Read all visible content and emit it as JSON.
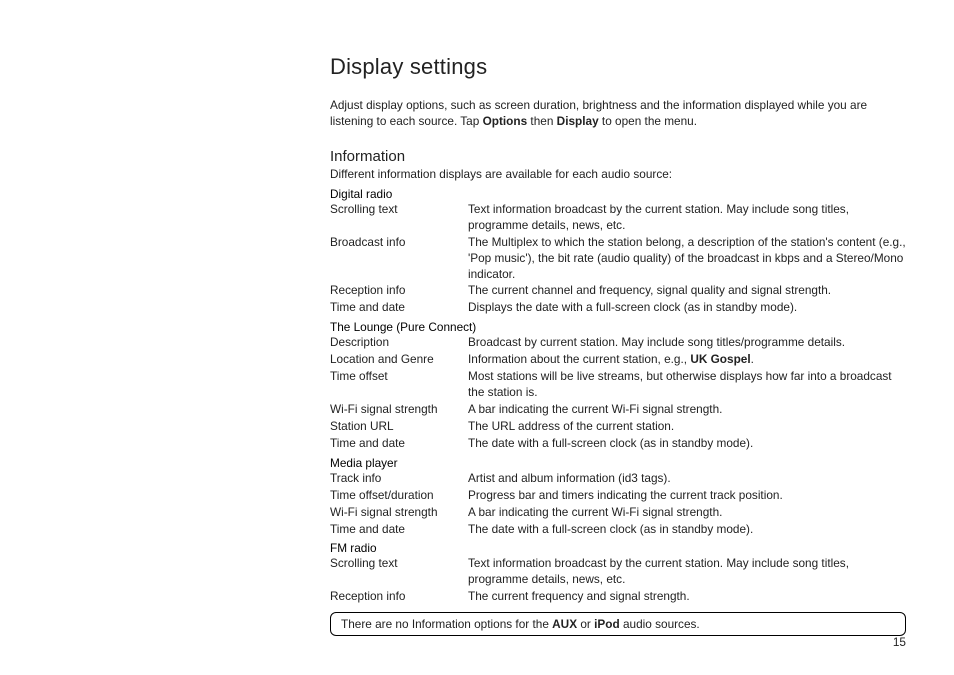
{
  "title": "Display settings",
  "intro_pre": "Adjust display options, such as screen duration, brightness and the information displayed while you are listening to each source. Tap ",
  "intro_b1": "Options",
  "intro_mid": " then ",
  "intro_b2": "Display",
  "intro_post": " to open the menu.",
  "info_head": "Information",
  "info_sub": "Different information displays are available for each audio source:",
  "groups": {
    "g1": {
      "head": "Digital radio",
      "r1t": "Scrolling text",
      "r1d": "Text information broadcast by the current station. May include song titles, programme details, news, etc.",
      "r2t": "Broadcast info",
      "r2d": "The Multiplex to which the station belong, a description of the station's content (e.g., 'Pop music'), the bit rate (audio quality) of the broadcast in kbps and a Stereo/Mono indicator.",
      "r3t": "Reception info",
      "r3d": "The current channel and frequency, signal quality and signal strength.",
      "r4t": "Time and date",
      "r4d": "Displays the date with a full-screen clock (as in standby mode)."
    },
    "g2": {
      "head": "The Lounge (Pure Connect)",
      "r1t": "Description",
      "r1d": "Broadcast by current station. May include song titles/programme details.",
      "r2t": "Location and Genre",
      "r2d_pre": "Information about the current station, e.g., ",
      "r2d_b": "UK Gospel",
      "r2d_post": ".",
      "r3t": "Time offset",
      "r3d": "Most stations will be live streams, but otherwise displays how far into a broadcast the station is.",
      "r4t": "Wi-Fi signal strength",
      "r4d": "A bar indicating the current Wi-Fi signal strength.",
      "r5t": "Station URL",
      "r5d": "The URL address of the current station.",
      "r6t": "Time and date",
      "r6d": "The date with a full-screen clock (as in standby mode)."
    },
    "g3": {
      "head": "Media player",
      "r1t": "Track info",
      "r1d": "Artist and album information (id3 tags).",
      "r2t": "Time offset/duration",
      "r2d": "Progress bar and timers indicating the current track position.",
      "r3t": "Wi-Fi signal strength",
      "r3d": "A bar indicating the current Wi-Fi signal strength.",
      "r4t": "Time and date",
      "r4d": "The date with a full-screen clock (as in standby mode)."
    },
    "g4": {
      "head": "FM radio",
      "r1t": "Scrolling text",
      "r1d": "Text information broadcast by the current station. May include song titles, programme details, news, etc.",
      "r2t": "Reception info",
      "r2d": "The current frequency and signal strength."
    }
  },
  "note_pre": "There are no Information options for the ",
  "note_b1": "AUX",
  "note_mid": " or ",
  "note_b2": "iPod",
  "note_post": " audio sources.",
  "page_number": "15"
}
